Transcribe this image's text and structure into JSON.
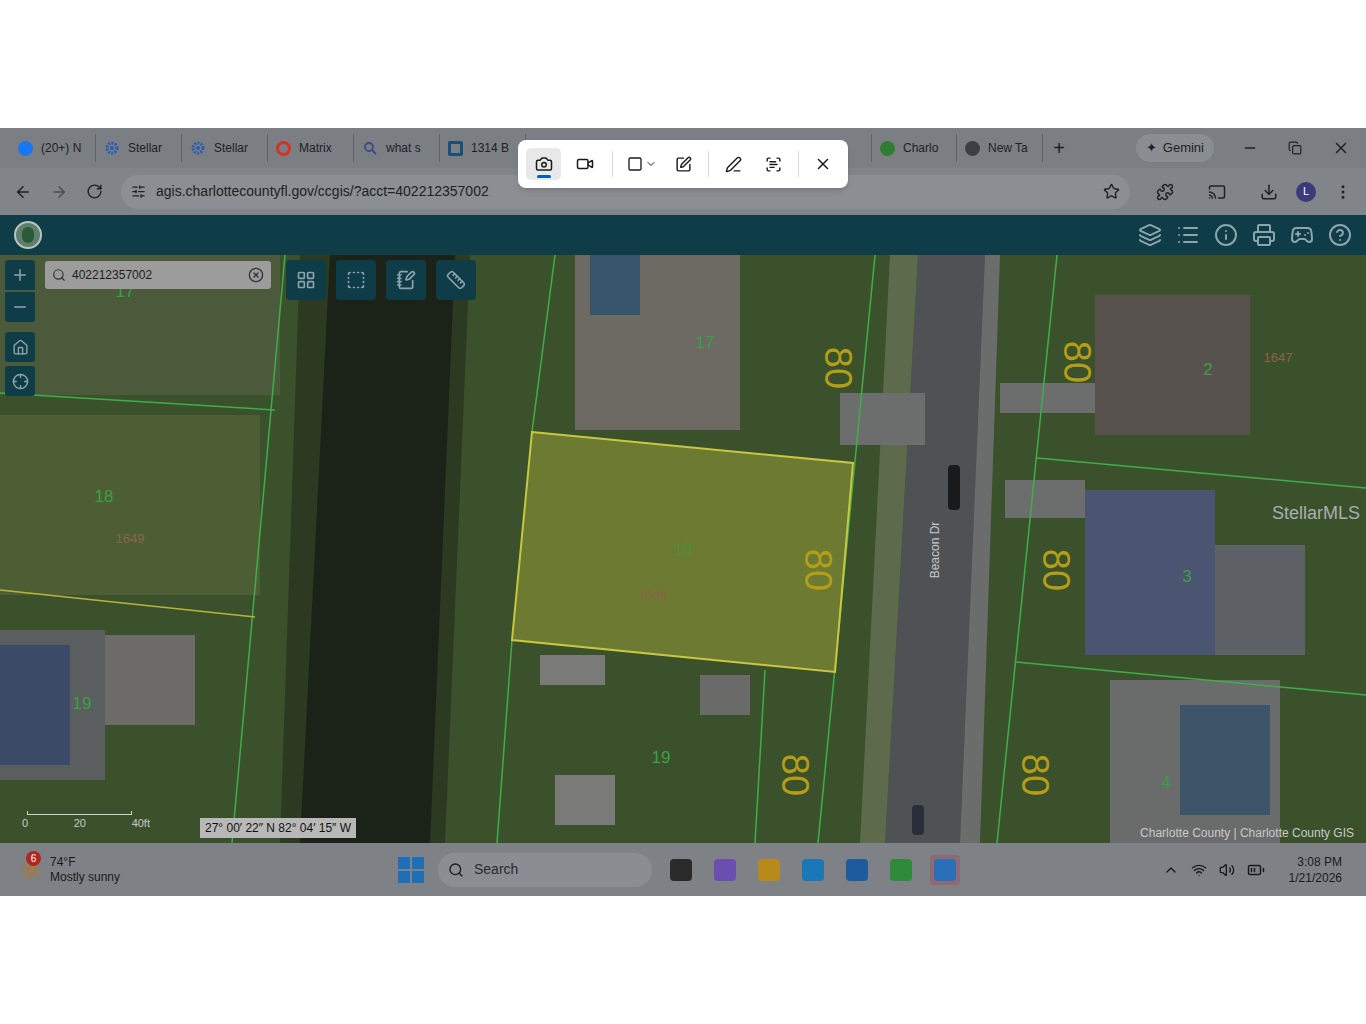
{
  "browser": {
    "tabs": [
      {
        "label": "(20+) N",
        "kind": "facebook",
        "color": "#1877f2"
      },
      {
        "label": "Stellar",
        "kind": "gear",
        "color": "#2a5db0"
      },
      {
        "label": "Stellar",
        "kind": "gear",
        "color": "#2a5db0"
      },
      {
        "label": "Matrix",
        "kind": "matrix",
        "color": "#d93025"
      },
      {
        "label": "what s",
        "kind": "search",
        "color": "#3c4a8a"
      },
      {
        "label": "1314 B",
        "kind": "site",
        "color": "#1a4f7a"
      },
      {
        "label": "Charlo",
        "kind": "globe",
        "color": "#2e7d32"
      },
      {
        "label": "New Ta",
        "kind": "globe",
        "color": "#3c4043"
      }
    ],
    "new_tab": "+",
    "gemini": {
      "mark": "✦",
      "label": "Gemini"
    },
    "url": "agis.charlottecountyfl.gov/ccgis/?acct=402212357002",
    "avatar": "L"
  },
  "snip_toolbar": {
    "modes": [
      {
        "name": "screenshot",
        "selected": true
      },
      {
        "name": "video",
        "selected": false
      }
    ]
  },
  "gis": {
    "search": {
      "value": "402212357002"
    }
  },
  "map": {
    "lots": [
      {
        "text": "17",
        "selected": false
      },
      {
        "text": "18",
        "selected": true
      },
      {
        "text": "19",
        "selected": false
      },
      {
        "text": "18",
        "selected": false
      },
      {
        "text": "19",
        "selected": false
      },
      {
        "text": "17",
        "selected": false
      },
      {
        "text": "2",
        "selected": false
      },
      {
        "text": "3",
        "selected": false
      },
      {
        "text": "4",
        "selected": false
      }
    ],
    "addresses": [
      "1649",
      "1648",
      "1647"
    ],
    "frontages": [
      "80",
      "80",
      "80",
      "80",
      "80",
      "80"
    ],
    "street": "Beacon Dr",
    "watermark": "StellarMLS",
    "scale": [
      "0",
      "20",
      "40ft"
    ],
    "coordinates": "27° 00′ 22″ N 82° 04′ 15″ W",
    "attribution": "Charlotte County | Charlotte County GIS"
  },
  "taskbar": {
    "weather": {
      "badge": "6",
      "temp": "74°F",
      "condition": "Mostly sunny"
    },
    "search": "Search",
    "time": "3:08 PM",
    "date": "1/21/2026"
  }
}
